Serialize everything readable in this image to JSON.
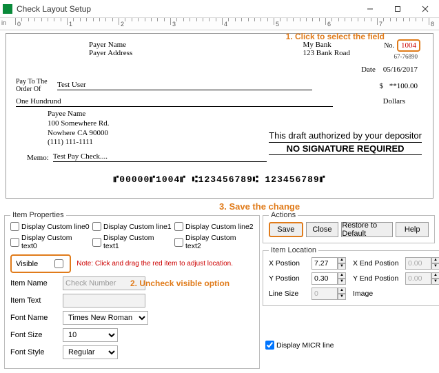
{
  "window": {
    "title": "Check Layout Setup"
  },
  "ruler": {
    "unit": "in",
    "labels": [
      "0",
      "1",
      "2",
      "3",
      "4",
      "5",
      "6",
      "7",
      "8"
    ]
  },
  "annotations": {
    "step1": "1. Click to select the field",
    "step2": "2. Uncheck visible option",
    "step3": "3. Save the change"
  },
  "check": {
    "payer_name": "Payer Name",
    "payer_address": "Payer Address",
    "bank_name": "My Bank",
    "bank_street": "123 Bank Road",
    "no_label": "No.",
    "check_number": "1004",
    "ref_number": "67-76890",
    "date_label": "Date",
    "date_value": "05/16/2017",
    "pay_to_label": "Pay To The Order Of",
    "pay_to_value": "Test User",
    "amount_symbol": "$",
    "amount_value": "**100.00",
    "amount_words": "One Hundrund",
    "dollars_label": "Dollars",
    "payee_name": "Payee Name",
    "payee_street": "100 Somewhere Rd.",
    "payee_city": "Nowhere CA 90000",
    "payee_phone": "(111) 111-1111",
    "auth_line1": "This draft authorized by your depositor",
    "auth_line2": "NO SIGNATURE REQUIRED",
    "memo_label": "Memo:",
    "memo_value": "Test Pay Check....",
    "micr": "⑈00000⑈1004⑈ ⑆123456789⑆ 123456789⑈"
  },
  "item_props": {
    "legend": "Item Properties",
    "custom_line0": "Display Custom line0",
    "custom_line1": "Display Custom line1",
    "custom_line2": "Display Custom line2",
    "custom_text0": "Display Custom text0",
    "custom_text1": "Display Custom text1",
    "custom_text2": "Display Custom text2",
    "visible_label": "Visible",
    "visible_note": "Note: Click and drag the red item to adjust location.",
    "item_name_label": "Item Name",
    "item_name_value": "Check Number",
    "item_text_label": "Item Text",
    "item_text_value": "",
    "font_name_label": "Font Name",
    "font_name_value": "Times New Roman",
    "font_size_label": "Font Size",
    "font_size_value": "10",
    "font_style_label": "Font Style",
    "font_style_value": "Regular"
  },
  "actions": {
    "legend": "Actions",
    "save": "Save",
    "close": "Close",
    "restore": "Restore to Default",
    "help": "Help"
  },
  "location": {
    "legend": "Item Location",
    "xpos_label": "X Postion",
    "xpos_value": "7.27",
    "xend_label": "X End Postion",
    "xend_value": "0.00",
    "ypos_label": "Y Postion",
    "ypos_value": "0.30",
    "yend_label": "Y End Postion",
    "yend_value": "0.00",
    "linesize_label": "Line Size",
    "linesize_value": "0",
    "image_label": "Image"
  },
  "micr_checkbox": "Display MICR line"
}
